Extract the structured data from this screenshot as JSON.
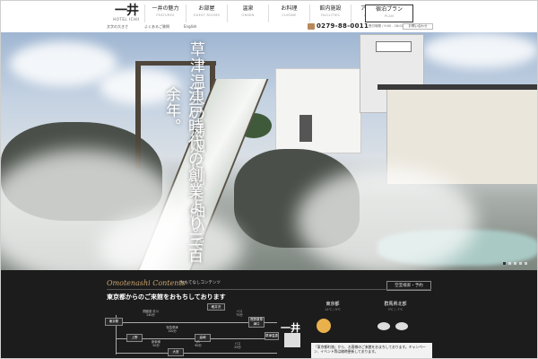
{
  "logo": {
    "mark": "一井",
    "sub": "HOTEL ICHII"
  },
  "nav": [
    {
      "jp": "一井の魅力",
      "en": "FEATURES"
    },
    {
      "jp": "お部屋",
      "en": "GUEST ROOMS"
    },
    {
      "jp": "温泉",
      "en": "ONSEN"
    },
    {
      "jp": "お料理",
      "en": "CUISINE"
    },
    {
      "jp": "館内施設",
      "en": "FACILITIES"
    },
    {
      "jp": "アクセス",
      "en": "ACCESS"
    }
  ],
  "plan": {
    "jp": "宿泊プラン",
    "en": "PLAN"
  },
  "subbar": {
    "font_size": "文字の大きさ",
    "faq": "よくあるご質問",
    "lang": "English",
    "phone": "0279-88-0011",
    "hours": "受付時間 / 9:00 - 18:00",
    "contact": "お問い合わせ"
  },
  "hero": {
    "copy_lines": [
      "草津温泉の湯畑に刻を紬いで",
      "江戸時代の創業より三百余年。"
    ],
    "slides_total": 5,
    "slide_active": 1
  },
  "bottom": {
    "section_en": "Omotenashi Contents",
    "section_jp": "おもてなしコンテンツ",
    "search_button": "空室検索・予約",
    "access_title": "東京都からのご来館をおもちしております"
  },
  "route": {
    "nodes": [
      "東京駅",
      "新宿",
      "関越道 渋川",
      "軽井沢",
      "上野",
      "高崎",
      "大宮",
      "長野原草津口",
      "草津温泉"
    ],
    "edges": [
      "関越道 渋川\n240分",
      "バス\n75分",
      "特急草津\n150分",
      "バス\n25分",
      "新幹線\n50分",
      "JR\n90分"
    ]
  },
  "weather": [
    {
      "place": "東京都",
      "temp": "14℃ / 5℃"
    },
    {
      "place": "群馬県北部",
      "temp": "3℃ / -7℃"
    }
  ],
  "news": "「東京都町旅」から、お客様のご来館をおまちしております。キャンペーン、イベント等は随時更新しております。"
}
